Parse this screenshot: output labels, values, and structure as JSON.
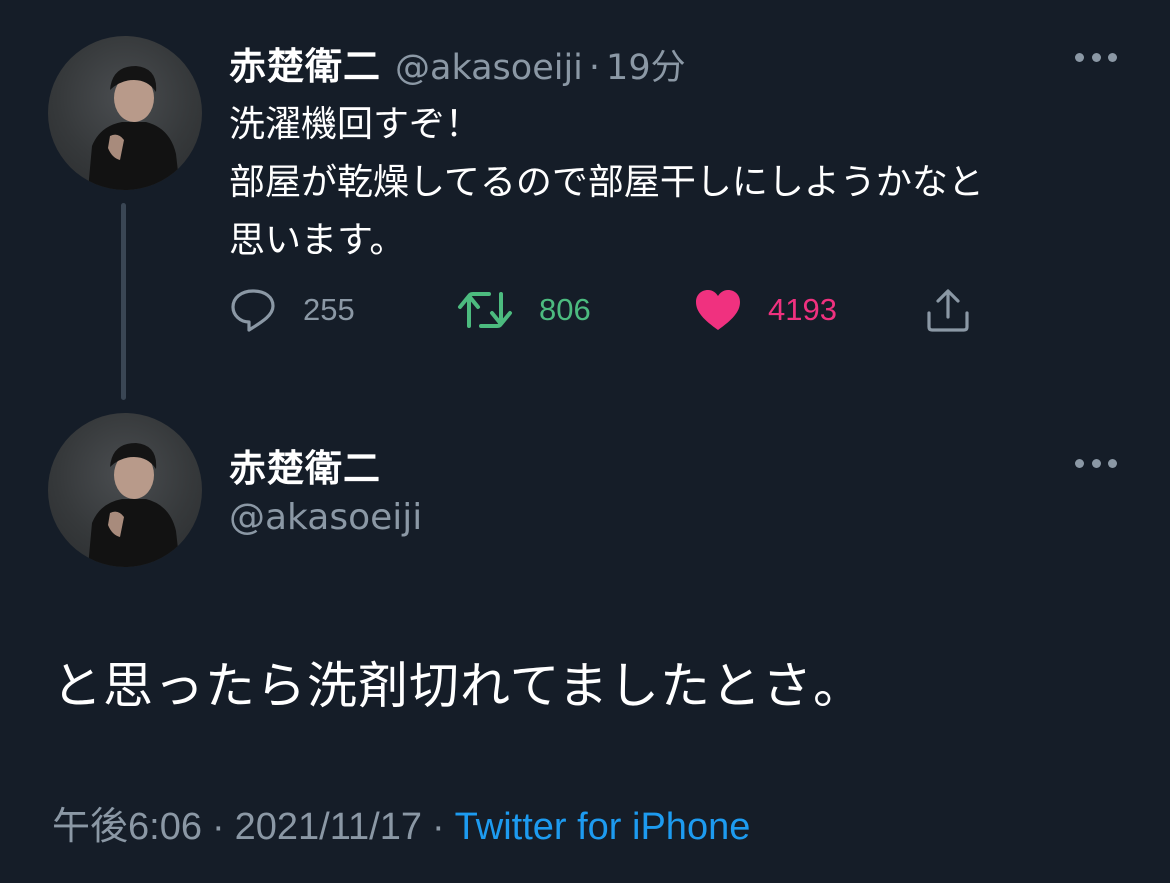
{
  "tweet1": {
    "name": "赤楚衛二",
    "handle": "@akasoeiji",
    "separator": "·",
    "time": "19分",
    "text": "洗濯機回すぞ！\n部屋が乾燥してるので部屋干しにしようかなと\n思います。",
    "lines": [
      "洗濯機回すぞ！",
      "部屋が乾燥してるので部屋干しにしようかなと",
      "思います。"
    ],
    "replies": "255",
    "retweets": "806",
    "likes": "4193",
    "liked": true
  },
  "tweet2": {
    "name": "赤楚衛二",
    "handle": "@akasoeiji",
    "text": "と思ったら洗剤切れてましたとさ。",
    "time": "午後6:06",
    "separator": "·",
    "date": "2021/11/17",
    "source": "Twitter for iPhone"
  },
  "colors": {
    "background": "#151d28",
    "secondary_text": "#8b98a5",
    "retweet_green": "#4cbb7f",
    "like_pink": "#f0317f",
    "link_blue": "#1d9bf0"
  },
  "icons": [
    "more-icon",
    "reply-icon",
    "retweet-icon",
    "heart-icon",
    "share-icon"
  ]
}
